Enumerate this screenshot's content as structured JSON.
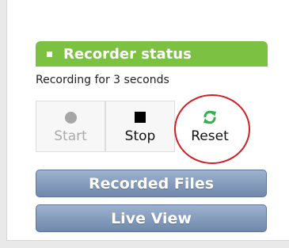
{
  "recorder": {
    "title": "Recorder status",
    "status_text": "Recording for 3 seconds",
    "buttons": [
      {
        "label": "Start",
        "icon": "circle-icon",
        "state": "disabled"
      },
      {
        "label": "Stop",
        "icon": "square-icon",
        "state": "enabled"
      },
      {
        "label": "Reset",
        "icon": "refresh-icon",
        "state": "enabled"
      }
    ]
  },
  "actions": {
    "recorded_files_label": "Recorded Files",
    "live_view_label": "Live View"
  },
  "colors": {
    "header_green": "#7cc142",
    "reset_icon_green": "#2fb24a",
    "button_blue_top": "#9db2cf",
    "button_blue_bottom": "#6f88ab",
    "highlight_red": "#d21f25"
  }
}
